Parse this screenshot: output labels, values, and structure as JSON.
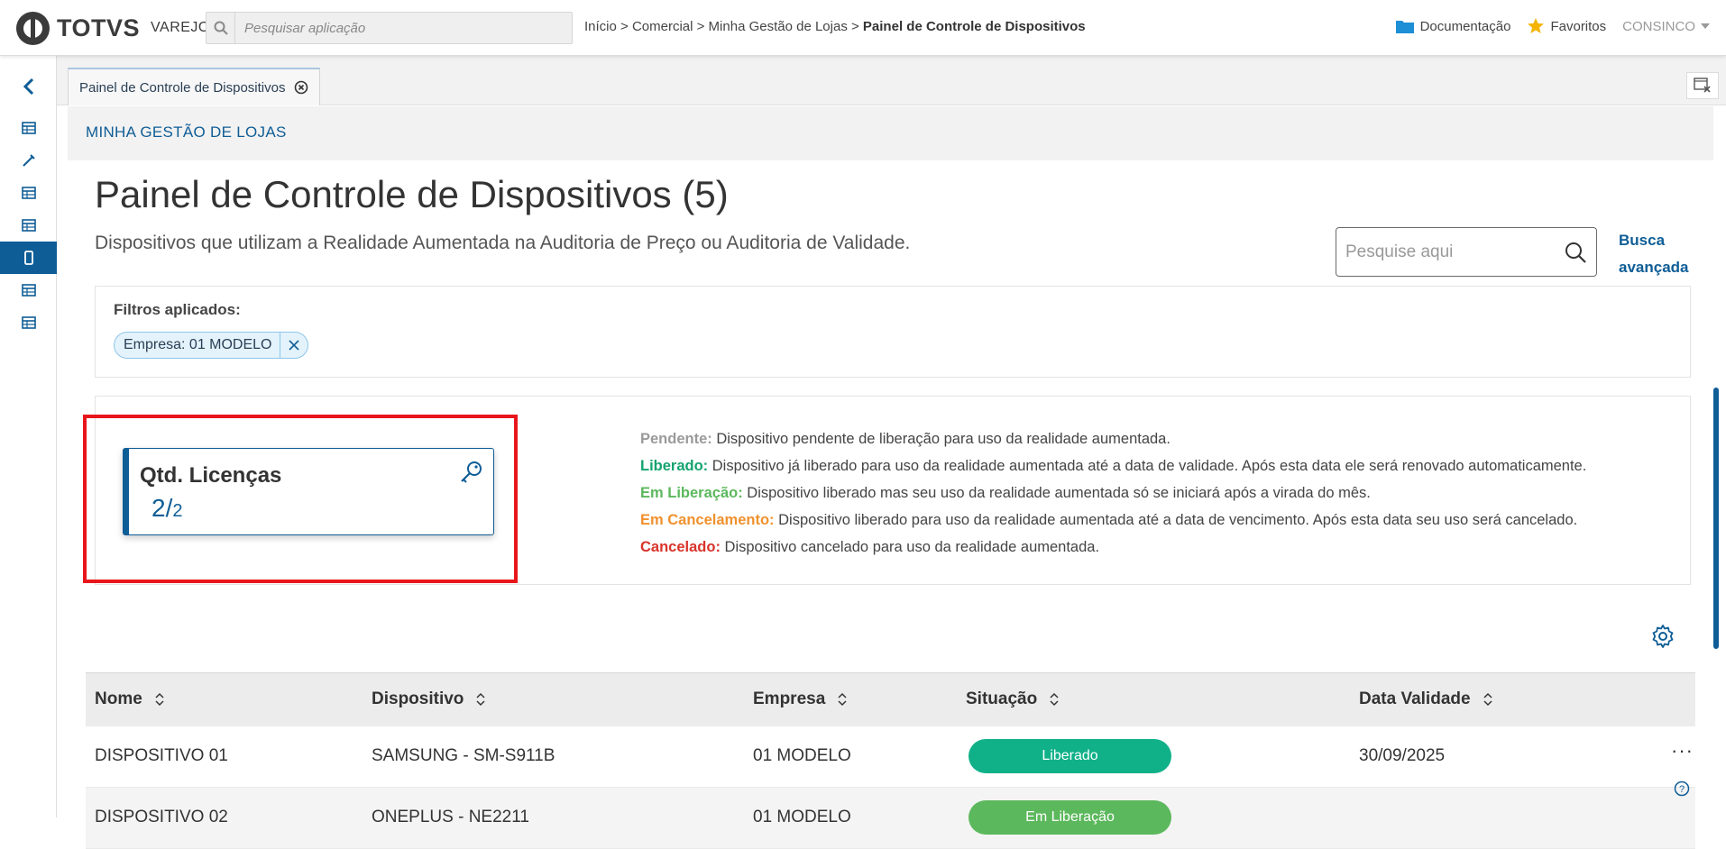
{
  "topbar": {
    "brand": "TOTVS",
    "brand_sub": "VAREJO",
    "search_placeholder": "Pesquisar aplicação",
    "breadcrumb_path": "Início > Comercial > Minha Gestão de Lojas > ",
    "breadcrumb_current": "Painel de Controle de Dispositivos",
    "documentation": "Documentação",
    "favorites": "Favoritos",
    "user": "CONSINCO"
  },
  "tabs": [
    {
      "label": "Painel de Controle de Dispositivos"
    }
  ],
  "section": {
    "title": "MINHA GESTÃO DE LOJAS"
  },
  "page": {
    "title": "Painel de Controle de Dispositivos (5)",
    "subtitle": "Dispositivos que utilizam a Realidade Aumentada na Auditoria de Preço ou Auditoria de Validade.",
    "search_placeholder": "Pesquise aqui",
    "advanced_search_line1": "Busca",
    "advanced_search_line2": "avançada"
  },
  "filters": {
    "label": "Filtros aplicados:",
    "chips": [
      {
        "text": "Empresa: 01 MODELO"
      }
    ]
  },
  "license_card": {
    "title": "Qtd. Licenças",
    "used": "2/",
    "total": "2"
  },
  "legend": [
    {
      "status": "Pendente:",
      "text": " Dispositivo pendente de liberação para uso da realidade aumentada.",
      "color": "#9a9a9a"
    },
    {
      "status": "Liberado:",
      "text": " Dispositivo já liberado para uso da realidade aumentada até a data de validade. Após esta data ele será renovado automaticamente.",
      "color": "#14a36e"
    },
    {
      "status": "Em Liberação:",
      "text": " Dispositivo liberado mas seu uso da realidade aumentada só se iniciará após a virada do mês.",
      "color": "#5cb85c"
    },
    {
      "status": "Em Cancelamento:",
      "text": " Dispositivo liberado para uso da realidade aumentada até a data de vencimento. Após esta data seu uso será cancelado.",
      "color": "#f0912d"
    },
    {
      "status": "Cancelado:",
      "text": " Dispositivo cancelado para uso da realidade aumentada.",
      "color": "#d9342b"
    }
  ],
  "table": {
    "columns": [
      "Nome",
      "Dispositivo",
      "Empresa",
      "Situação",
      "Data Validade"
    ],
    "rows": [
      {
        "nome": "DISPOSITIVO 01",
        "dispositivo": "SAMSUNG - SM-S911B",
        "empresa": "01 MODELO",
        "situacao": "Liberado",
        "situacao_color": "#10b188",
        "validade": "30/09/2025",
        "more": "···"
      },
      {
        "nome": "DISPOSITIVO 02",
        "dispositivo": "ONEPLUS - NE2211",
        "empresa": "01 MODELO",
        "situacao": "Em Liberação",
        "situacao_color": "#5cb85c",
        "validade": "",
        "more": ""
      }
    ]
  },
  "colors": {
    "primary": "#0f5d96",
    "highlight": "#e8161b"
  }
}
